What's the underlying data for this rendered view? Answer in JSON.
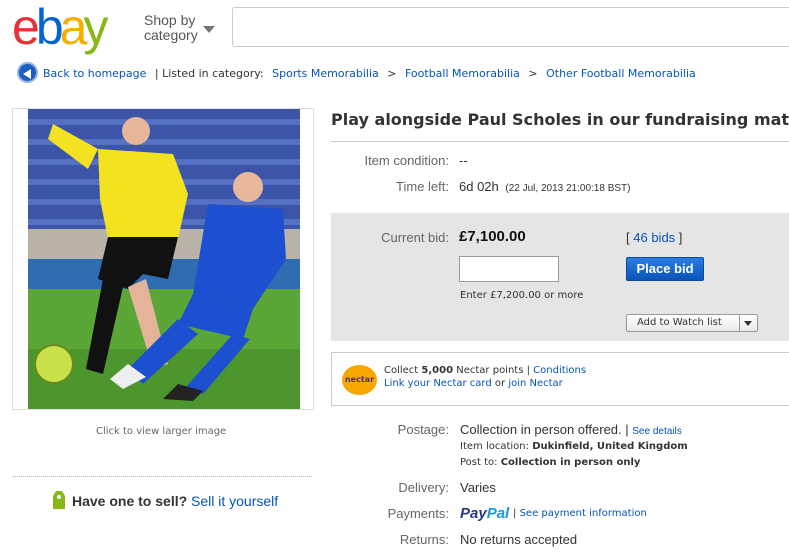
{
  "header": {
    "logo": [
      "e",
      "b",
      "a",
      "y"
    ],
    "logo_colors": [
      "#e53238",
      "#0064d2",
      "#f5af02",
      "#86b817"
    ],
    "shop_by_line1": "Shop by",
    "shop_by_line2": "category",
    "search_placeholder": ""
  },
  "breadcrumb": {
    "back_label": "Back to homepage",
    "listed_in": "| Listed in category:",
    "items": [
      "Sports Memorabilia",
      "Football Memorabilia",
      "Other Football Memorabilia"
    ],
    "separator": ">"
  },
  "image_panel": {
    "click_larger": "Click to view larger image"
  },
  "sell": {
    "question": "Have one to sell?",
    "link": "Sell it yourself"
  },
  "listing": {
    "title": "Play alongside Paul Scholes in our fundraising match",
    "condition_label": "Item condition:",
    "condition_value": "--",
    "time_left_label": "Time left:",
    "time_left_value": "6d 02h",
    "time_left_end": "(22 Jul, 2013  21:00:18 BST)"
  },
  "bid": {
    "current_label": "Current bid:",
    "amount": "£7,100.00",
    "bids_open": "[",
    "bids_count": "46 bids",
    "bids_close": "]",
    "input_value": "",
    "place_bid": "Place bid",
    "enter_hint": "Enter £7,200.00 or more",
    "watch_list": "Add to Watch list"
  },
  "nectar": {
    "logo_text": "nectar",
    "collect_prefix": "Collect",
    "points": "5,000",
    "collect_suffix": "Nectar points |",
    "conditions": "Conditions",
    "link_card": "Link your Nectar card",
    "or": "or",
    "join": "join Nectar"
  },
  "details": {
    "postage_label": "Postage:",
    "postage_value": "Collection in person offered. |",
    "see_details": "See details",
    "location_label": "Item location:",
    "location_value": "Dukinfield, United Kingdom",
    "post_to_label": "Post to:",
    "post_to_value": "Collection in person only",
    "delivery_label": "Delivery:",
    "delivery_value": "Varies",
    "payments_label": "Payments:",
    "paypal_pay": "Pay",
    "paypal_pal": "Pal",
    "payment_sep": "|",
    "payment_info": "See payment information",
    "returns_label": "Returns:",
    "returns_value": "No returns accepted"
  }
}
